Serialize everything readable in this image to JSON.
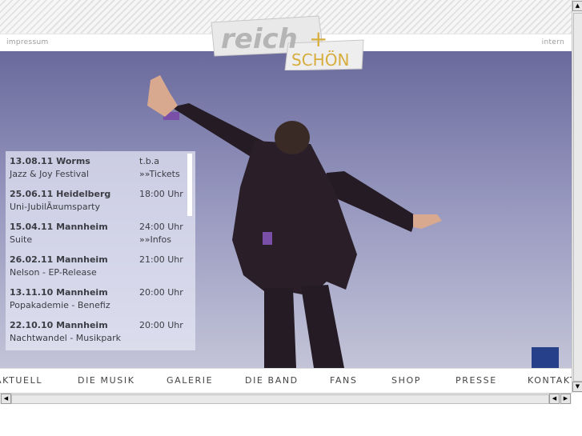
{
  "header": {
    "impressum": "impressum",
    "intern": "intern",
    "logo_top": "reich",
    "logo_plus": "+",
    "logo_bottom": "SCHÖN"
  },
  "events": [
    {
      "date": "13.08.11 Worms",
      "name": "Jazz & Joy Festival",
      "time": "t.b.a",
      "extra": "»»Tickets"
    },
    {
      "date": "25.06.11 Heidelberg",
      "name": "Uni-JubilÃ¤umsparty",
      "time": "18:00 Uhr",
      "extra": ""
    },
    {
      "date": "15.04.11 Mannheim",
      "name": "Suite",
      "time": "24:00 Uhr",
      "extra": "»»Infos"
    },
    {
      "date": "26.02.11 Mannheim",
      "name": "Nelson - EP-Release",
      "time": "21:00 Uhr",
      "extra": ""
    },
    {
      "date": "13.11.10 Mannheim",
      "name": "Popakademie - Benefiz",
      "time": "20:00 Uhr",
      "extra": ""
    },
    {
      "date": "22.10.10 Mannheim",
      "name": "Nachtwandel - Musikpark",
      "time": "20:00 Uhr",
      "extra": ""
    }
  ],
  "nav": [
    "AKTUELL",
    "DIE MUSIK",
    "GALERIE",
    "DIE BAND",
    "FANS",
    "SHOP",
    "PRESSE",
    "KONTAKT"
  ],
  "icons": {
    "scroll_up": "arrow-up-icon",
    "scroll_down": "arrow-down-icon",
    "scroll_left": "arrow-left-icon",
    "scroll_right": "arrow-right-icon",
    "facebook": "facebook-icon"
  }
}
